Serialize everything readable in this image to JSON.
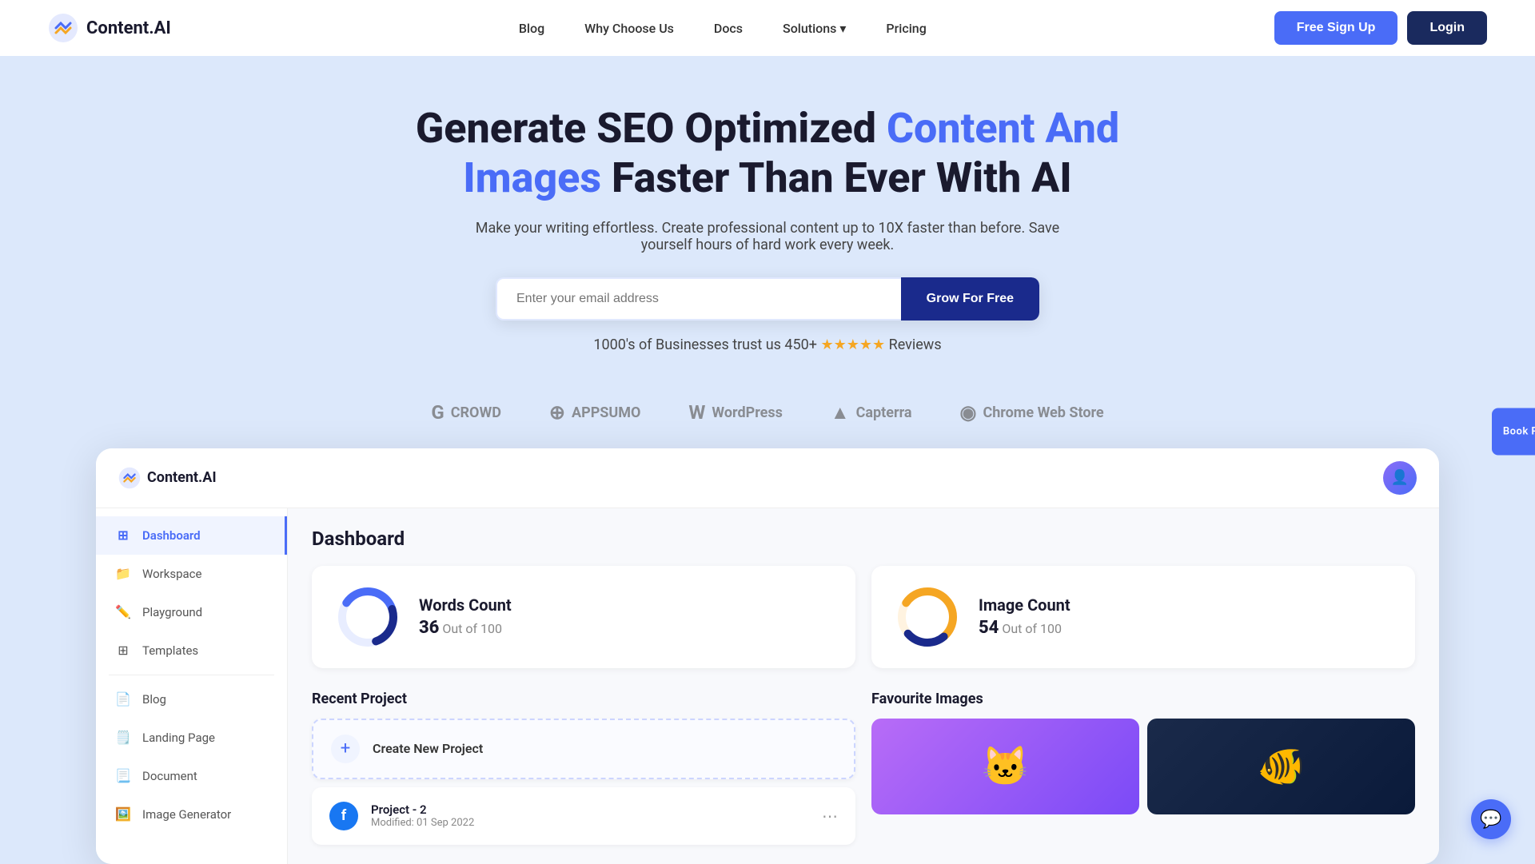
{
  "navbar": {
    "logo_text": "Content.AI",
    "links": [
      {
        "label": "Blog",
        "id": "blog"
      },
      {
        "label": "Why Choose Us",
        "id": "why-choose-us"
      },
      {
        "label": "Docs",
        "id": "docs"
      },
      {
        "label": "Solutions",
        "id": "solutions",
        "has_dropdown": true
      },
      {
        "label": "Pricing",
        "id": "pricing"
      }
    ],
    "free_signup_label": "Free Sign Up",
    "login_label": "Login"
  },
  "hero": {
    "title_part1": "Generate SEO Optimized ",
    "title_accent": "Content And Images",
    "title_part2": " Faster Than Ever With AI",
    "subtitle": "Make your writing effortless. Create professional content up to 10X faster than before. Save yourself hours of hard work every week.",
    "email_placeholder": "Enter your email address",
    "cta_label": "Grow For Free",
    "trust_text": "1000's of Businesses trust us 450+",
    "trust_suffix": " Reviews",
    "stars": "★★★★★"
  },
  "logos": [
    {
      "text": "CROWD",
      "symbol": "G"
    },
    {
      "text": "APPSUMO",
      "symbol": "⊕"
    },
    {
      "text": "WordPress",
      "symbol": "W"
    },
    {
      "text": "Capterra",
      "symbol": "▲"
    },
    {
      "text": "Chrome Web Store",
      "symbol": "◉"
    }
  ],
  "dashboard": {
    "logo_text": "Content.AI",
    "title": "Dashboard",
    "sidebar": {
      "items": [
        {
          "label": "Dashboard",
          "icon": "⊞",
          "active": true,
          "id": "dashboard"
        },
        {
          "label": "Workspace",
          "icon": "📁",
          "active": false,
          "id": "workspace"
        },
        {
          "label": "Playground",
          "icon": "✏️",
          "active": false,
          "id": "playground"
        },
        {
          "label": "Templates",
          "icon": "⊞",
          "active": false,
          "id": "templates"
        },
        {
          "label": "Blog",
          "icon": "📄",
          "active": false,
          "id": "blog"
        },
        {
          "label": "Landing Page",
          "icon": "🗒️",
          "active": false,
          "id": "landing-page"
        },
        {
          "label": "Document",
          "icon": "📃",
          "active": false,
          "id": "document"
        },
        {
          "label": "Image Generator",
          "icon": "🖼️",
          "active": false,
          "id": "image-generator"
        }
      ]
    },
    "stats": [
      {
        "id": "words-count",
        "label": "Words Count",
        "value": "36",
        "out_of": "Out of 100",
        "percentage": 36,
        "color_primary": "#4a6cf7",
        "color_secondary": "#f0f4ff"
      },
      {
        "id": "image-count",
        "label": "Image Count",
        "value": "54",
        "out_of": "Out of 100",
        "percentage": 54,
        "color_primary": "#f5a623",
        "color_secondary": "#fff3e0"
      }
    ],
    "recent_project": {
      "title": "Recent Project",
      "create_label": "Create New Project",
      "projects": [
        {
          "id": "project-2",
          "name": "Project - 2",
          "modified": "Modified: 01 Sep 2022",
          "icon_type": "facebook"
        }
      ]
    },
    "favourite_images": {
      "title": "Favourite Images",
      "images": [
        {
          "id": "cat-vr",
          "emoji": "🐱",
          "bg": "purple"
        },
        {
          "id": "fish-bowl",
          "emoji": "🐠",
          "bg": "dark"
        }
      ]
    }
  },
  "side_demo": {
    "label": "Book Personalized Demo"
  },
  "chat": {
    "icon": "💬"
  }
}
